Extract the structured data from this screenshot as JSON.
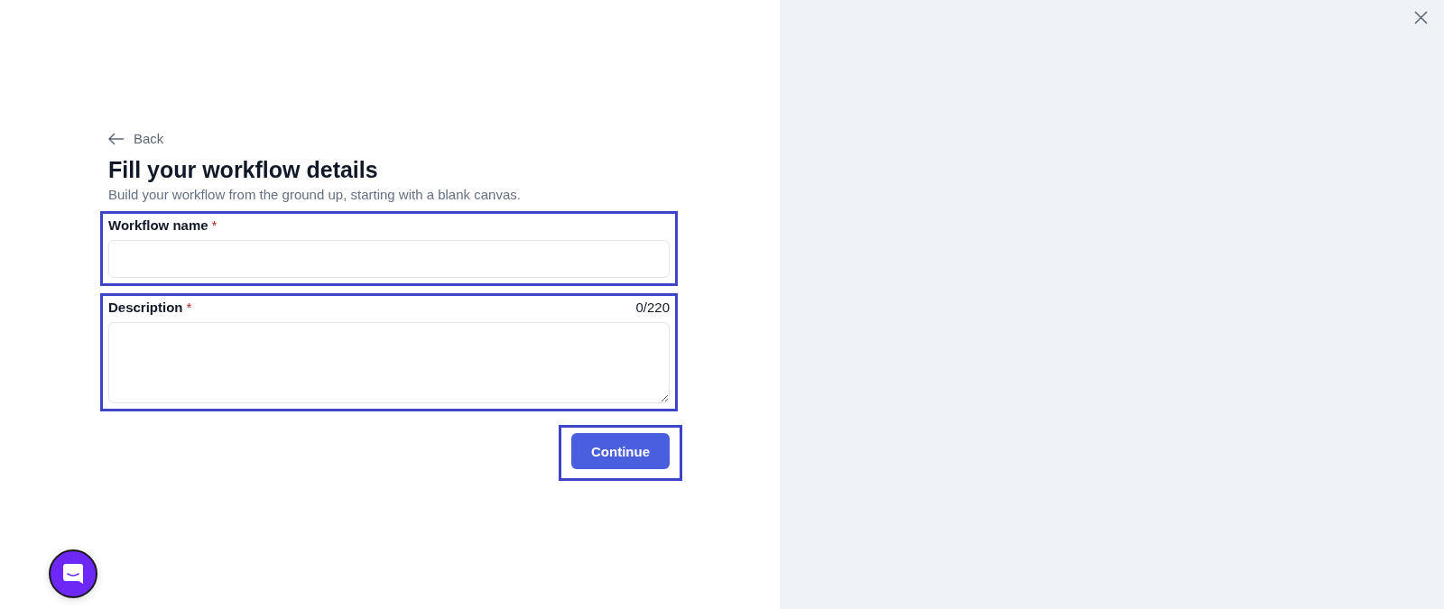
{
  "back_link": {
    "label": "Back"
  },
  "title": "Fill your workflow details",
  "subtitle": "Build your workflow from the ground up, starting with a blank canvas.",
  "fields": [
    {
      "kind": "input",
      "label": "Workflow name",
      "required_mark": "*",
      "highlighted": true
    },
    {
      "kind": "textarea",
      "label": "Description",
      "required_mark": "*",
      "counter": "0/220",
      "highlighted": true
    }
  ],
  "continue_button": {
    "label": "Continue",
    "highlighted": true
  }
}
